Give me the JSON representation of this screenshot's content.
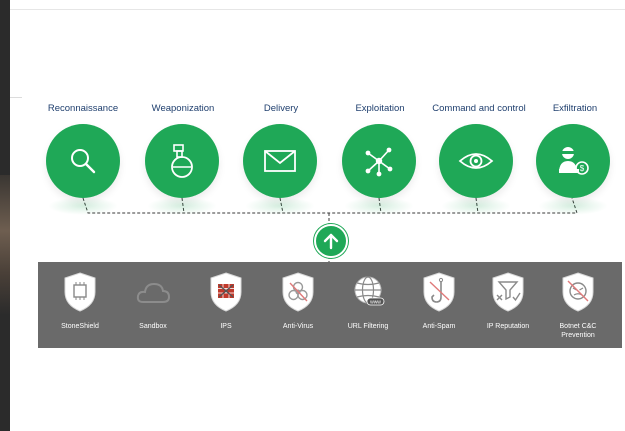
{
  "stages": [
    {
      "label": "Reconnaissance",
      "icon": "magnifier-icon"
    },
    {
      "label": "Weaponization",
      "icon": "flask-icon"
    },
    {
      "label": "Delivery",
      "icon": "envelope-icon"
    },
    {
      "label": "Exploitation",
      "icon": "network-icon"
    },
    {
      "label": "Command and control",
      "icon": "eye-icon"
    },
    {
      "label": "Exfiltration",
      "icon": "thief-icon"
    }
  ],
  "arrow": {
    "icon": "arrow-up-icon"
  },
  "tools": [
    {
      "label": "StoneShield",
      "icon": "shield-chip-icon"
    },
    {
      "label": "Sandbox",
      "icon": "cloud-icon"
    },
    {
      "label": "IPS",
      "icon": "firewall-icon"
    },
    {
      "label": "Anti-Virus",
      "icon": "biohazard-icon"
    },
    {
      "label": "URL Filtering",
      "icon": "globe-www-icon"
    },
    {
      "label": "Anti-Spam",
      "icon": "hook-icon"
    },
    {
      "label": "IP Reputation",
      "icon": "filter-icon"
    },
    {
      "label": "Botnet C&C Prevention",
      "icon": "botnet-face-icon"
    }
  ],
  "colors": {
    "green": "#1fa857",
    "label_blue": "#1f3f6e",
    "panel_gray": "#6a6a6a"
  }
}
